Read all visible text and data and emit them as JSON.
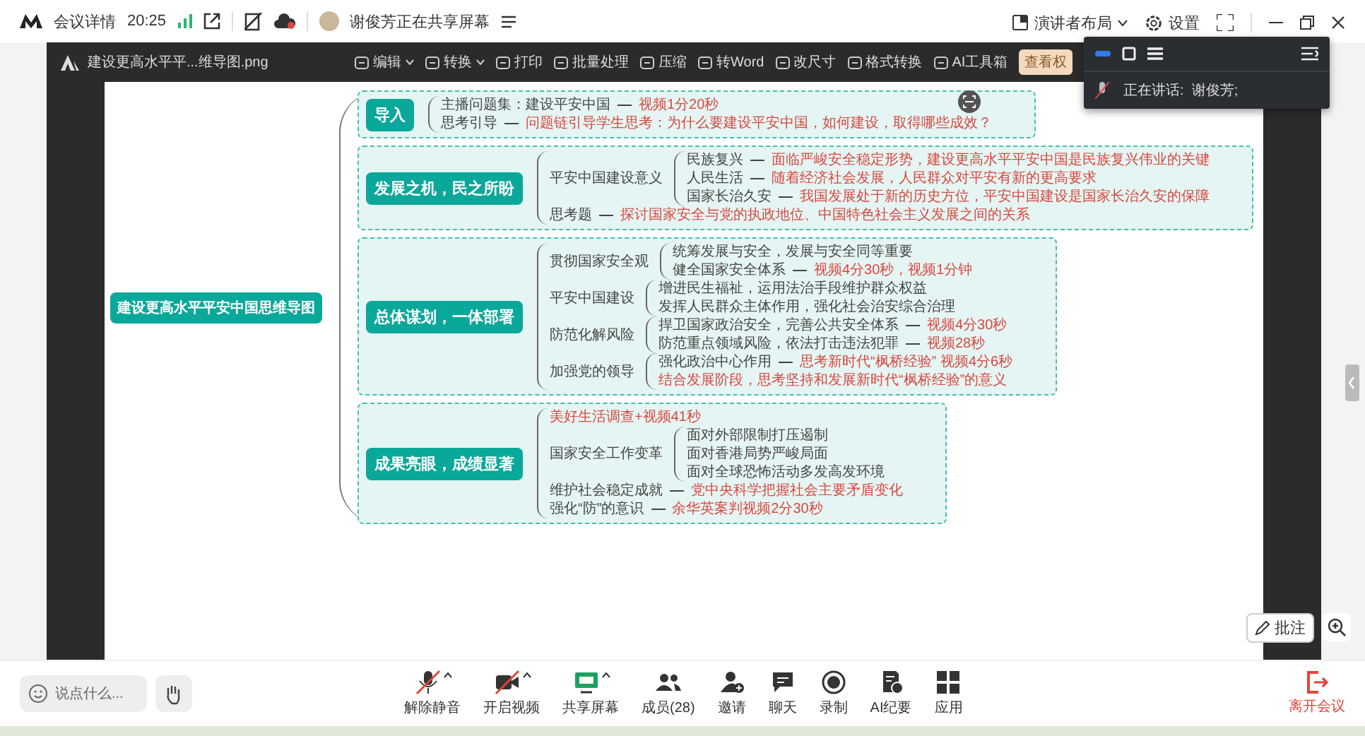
{
  "top_bar": {
    "meeting_info": "会议详情",
    "time": "20:25",
    "sharing_status": "谢俊芳正在共享屏幕",
    "layout_button": "演讲者布局",
    "settings_button": "设置"
  },
  "viewer": {
    "file_name": "建设更高水平平...维导图.png",
    "rights_badge": "查看权",
    "tools": [
      {
        "label": "编辑",
        "menu": true
      },
      {
        "label": "转换",
        "menu": true
      },
      {
        "label": "打印",
        "menu": false
      },
      {
        "label": "批量处理",
        "menu": false
      },
      {
        "label": "压缩",
        "menu": false
      },
      {
        "label": "转Word",
        "menu": false
      },
      {
        "label": "改尺寸",
        "menu": false
      },
      {
        "label": "格式转换",
        "menu": false
      },
      {
        "label": "AI工具箱",
        "menu": false
      }
    ]
  },
  "mind_map": {
    "root": "建设更高水平平安中国思维导图",
    "branches": [
      {
        "label": "导入",
        "children": [
          {
            "label": "主播问题集：建设平安中国",
            "kind": "topic",
            "note": "视频1分20秒"
          },
          {
            "label": "思考引导",
            "kind": "topic",
            "note": "问题链引导学生思考：为什么要建设平安中国，如何建设，取得哪些成效？"
          }
        ]
      },
      {
        "label": "发展之机，民之所盼",
        "children": [
          {
            "label": "平安中国建设意义",
            "kind": "topic",
            "children": [
              {
                "label": "民族复兴",
                "kind": "topic",
                "note": "面临严峻安全稳定形势，建设更高水平平安中国是民族复兴伟业的关键"
              },
              {
                "label": "人民生活",
                "kind": "topic",
                "note": "随着经济社会发展，人民群众对平安有新的更高要求"
              },
              {
                "label": "国家长治久安",
                "kind": "topic",
                "note": "我国发展处于新的历史方位，平安中国建设是国家长治久安的保障"
              }
            ]
          },
          {
            "label": "思考题",
            "kind": "topic",
            "note": "探讨国家安全与党的执政地位、中国特色社会主义发展之间的关系"
          }
        ]
      },
      {
        "label": "总体谋划，一体部署",
        "children": [
          {
            "label": "贯彻国家安全观",
            "kind": "topic",
            "children": [
              {
                "label": "统筹发展与安全，发展与安全同等重要",
                "kind": "topic"
              },
              {
                "label": "健全国家安全体系",
                "kind": "topic",
                "note": "视频4分30秒，视频1分钟"
              }
            ]
          },
          {
            "label": "平安中国建设",
            "kind": "topic",
            "children": [
              {
                "label": "增进民生福祉，运用法治手段维护群众权益",
                "kind": "topic"
              },
              {
                "label": "发挥人民群众主体作用，强化社会治安综合治理",
                "kind": "topic"
              }
            ]
          },
          {
            "label": "防范化解风险",
            "kind": "topic",
            "children": [
              {
                "label": "捍卫国家政治安全，完善公共安全体系",
                "kind": "topic",
                "note": "视频4分30秒"
              },
              {
                "label": "防范重点领域风险，依法打击违法犯罪",
                "kind": "topic",
                "note": "视频28秒"
              }
            ]
          },
          {
            "label": "加强党的领导",
            "kind": "topic",
            "children": [
              {
                "label": "强化政治中心作用",
                "kind": "topic",
                "note": "思考新时代“枫桥经验” 视频4分6秒"
              },
              {
                "label": "结合发展阶段，思考坚持和发展新时代“枫桥经验”的意义",
                "kind": "highlight"
              }
            ]
          }
        ]
      },
      {
        "label": "成果亮眼，成绩显著",
        "children": [
          {
            "label": "美好生活调查+视频41秒",
            "kind": "highlight"
          },
          {
            "label": "国家安全工作变革",
            "kind": "topic",
            "children": [
              {
                "label": "面对外部限制打压遏制",
                "kind": "topic"
              },
              {
                "label": "面对香港局势严峻局面",
                "kind": "topic"
              },
              {
                "label": "面对全球恐怖活动多发高发环境",
                "kind": "topic"
              }
            ]
          },
          {
            "label": "维护社会稳定成就",
            "kind": "topic",
            "note": "党中央科学把握社会主要矛盾变化"
          },
          {
            "label": "强化“防”的意识",
            "kind": "topic",
            "note": "余华英案判视频2分30秒"
          }
        ]
      }
    ]
  },
  "speaker_panel": {
    "speaking": "正在讲话:  谢俊芳;"
  },
  "annotate_button": "批注",
  "bottom_bar": {
    "chat_placeholder": "说点什么...",
    "leave_button": "离开会议",
    "controls": [
      {
        "kind": "mic",
        "label": "解除静音",
        "off": true,
        "menu": true
      },
      {
        "kind": "camera",
        "label": "开启视频",
        "off": true,
        "menu": true
      },
      {
        "kind": "share",
        "label": "共享屏幕",
        "off": false,
        "menu": true
      },
      {
        "kind": "members",
        "label": "成员(28)",
        "off": false,
        "menu": false
      },
      {
        "kind": "invite",
        "label": "邀请",
        "off": false,
        "menu": false
      },
      {
        "kind": "chat",
        "label": "聊天",
        "off": false,
        "menu": false
      },
      {
        "kind": "record",
        "label": "录制",
        "off": false,
        "menu": false
      },
      {
        "kind": "ai",
        "label": "AI纪要",
        "off": false,
        "menu": false
      },
      {
        "kind": "apps",
        "label": "应用",
        "off": false,
        "menu": false
      }
    ]
  }
}
